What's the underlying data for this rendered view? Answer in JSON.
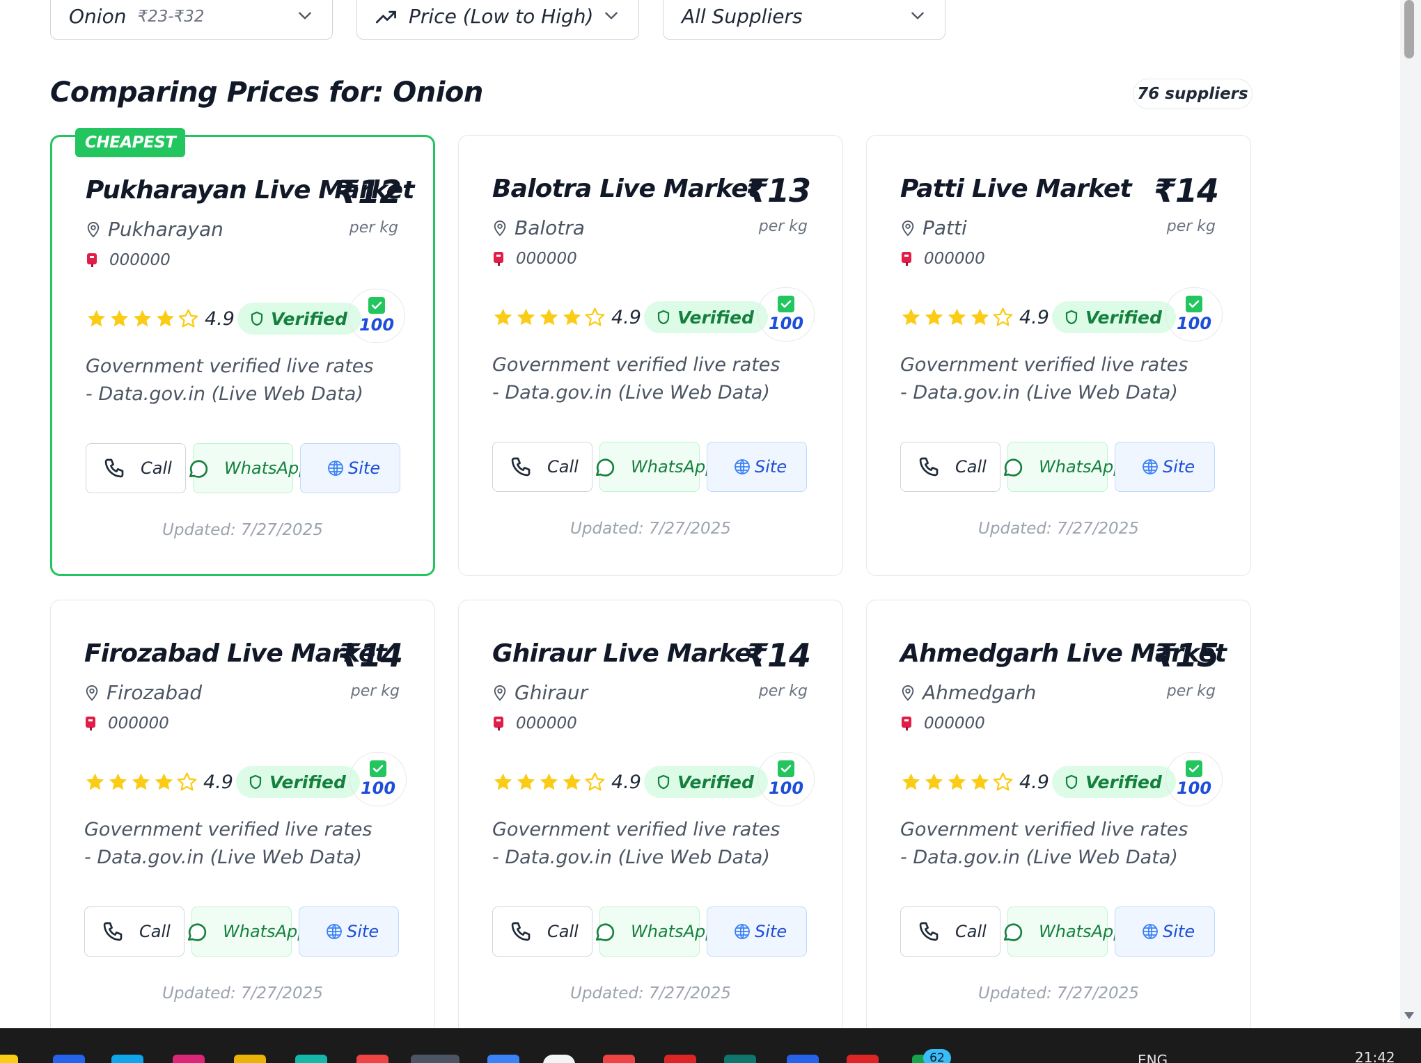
{
  "filters": {
    "product": {
      "value": "Onion",
      "range": "₹23-₹32"
    },
    "sort": {
      "value": "Price (Low to High)"
    },
    "supplier": {
      "value": "All Suppliers"
    }
  },
  "heading": {
    "title": "Comparing Prices for: Onion",
    "count": "76 suppliers"
  },
  "labels": {
    "cheapest": "CHEAPEST",
    "per_kg": "per kg",
    "verified": "Verified",
    "call": "Call",
    "whatsapp": "WhatsApp",
    "site": "Site"
  },
  "cards": [
    {
      "name": "Pukharayan Live Market",
      "price": "₹12",
      "location": "Pukharayan",
      "pincode": "000000",
      "rating": "4.9",
      "stars": 4,
      "score": "100",
      "description": "Government verified live rates - Data.gov.in (Live Web Data)",
      "updated": "Updated: 7/27/2025"
    },
    {
      "name": "Balotra Live Market",
      "price": "₹13",
      "location": "Balotra",
      "pincode": "000000",
      "rating": "4.9",
      "stars": 4,
      "score": "100",
      "description": "Government verified live rates - Data.gov.in (Live Web Data)",
      "updated": "Updated: 7/27/2025"
    },
    {
      "name": "Patti Live Market",
      "price": "₹14",
      "location": "Patti",
      "pincode": "000000",
      "rating": "4.9",
      "stars": 4,
      "score": "100",
      "description": "Government verified live rates - Data.gov.in (Live Web Data)",
      "updated": "Updated: 7/27/2025"
    },
    {
      "name": "Firozabad Live Market",
      "price": "₹14",
      "location": "Firozabad",
      "pincode": "000000",
      "rating": "4.9",
      "stars": 4,
      "score": "100",
      "description": "Government verified live rates - Data.gov.in (Live Web Data)",
      "updated": "Updated: 7/27/2025"
    },
    {
      "name": "Ghiraur Live Market",
      "price": "₹14",
      "location": "Ghiraur",
      "pincode": "000000",
      "rating": "4.9",
      "stars": 4,
      "score": "100",
      "description": "Government verified live rates - Data.gov.in (Live Web Data)",
      "updated": "Updated: 7/27/2025"
    },
    {
      "name": "Ahmedgarh Live Market",
      "price": "₹15",
      "location": "Ahmedgarh",
      "pincode": "000000",
      "rating": "4.9",
      "stars": 4,
      "score": "100",
      "description": "Government verified live rates - Data.gov.in (Live Web Data)",
      "updated": "Updated: 7/27/2025"
    }
  ],
  "taskbar": {
    "language": "ENG",
    "time": "21:42",
    "notification_count": "62"
  },
  "colors": {
    "accent_green": "#22c55e",
    "verified_bg": "#dcfce7",
    "site_blue": "#1d4ed8",
    "star": "#facc15"
  },
  "icons": [
    "chevron-down-icon",
    "trending-up-icon",
    "map-pin-icon",
    "postbox-icon",
    "star-icon",
    "shield-icon",
    "check-icon",
    "phone-icon",
    "whatsapp-icon",
    "globe-icon"
  ]
}
